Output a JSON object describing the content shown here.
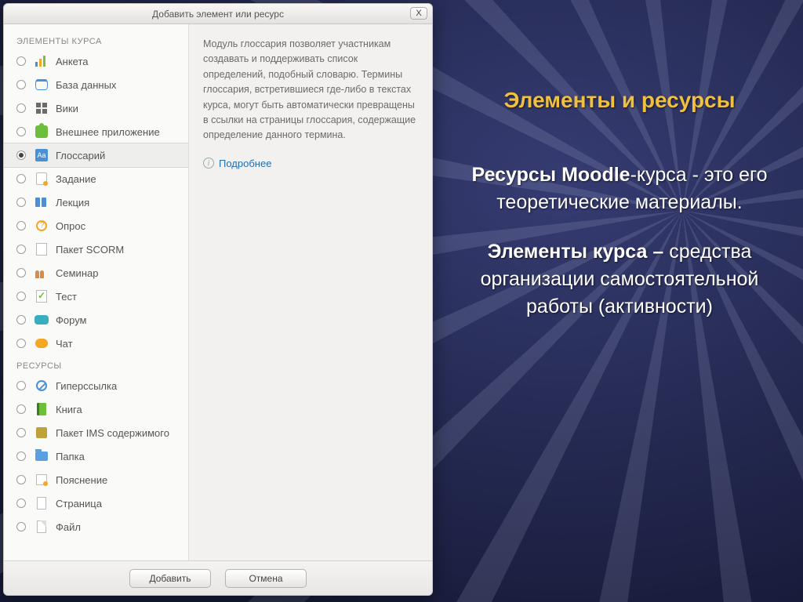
{
  "slide": {
    "title": "Элементы и ресурсы",
    "para1_lead": "Ресурсы Moodle",
    "para1_rest": "-курса - это его теоретические материалы.",
    "para2_lead": "Элементы курса –",
    "para2_rest": " средства организации самостоятельной работы (активности)"
  },
  "dialog": {
    "title": "Добавить элемент или ресурс",
    "close_label": "X",
    "section_activities": "ЭЛЕМЕНТЫ КУРСА",
    "section_resources": "РЕСУРСЫ",
    "activities": [
      {
        "label": "Анкета",
        "icon": "survey"
      },
      {
        "label": "База данных",
        "icon": "database"
      },
      {
        "label": "Вики",
        "icon": "wiki"
      },
      {
        "label": "Внешнее приложение",
        "icon": "lti"
      },
      {
        "label": "Глоссарий",
        "icon": "glossary",
        "selected": true
      },
      {
        "label": "Задание",
        "icon": "assignment"
      },
      {
        "label": "Лекция",
        "icon": "lesson"
      },
      {
        "label": "Опрос",
        "icon": "choice"
      },
      {
        "label": "Пакет SCORM",
        "icon": "scorm"
      },
      {
        "label": "Семинар",
        "icon": "workshop"
      },
      {
        "label": "Тест",
        "icon": "quiz"
      },
      {
        "label": "Форум",
        "icon": "forum"
      },
      {
        "label": "Чат",
        "icon": "chat"
      }
    ],
    "resources": [
      {
        "label": "Гиперссылка",
        "icon": "url"
      },
      {
        "label": "Книга",
        "icon": "book"
      },
      {
        "label": "Пакет IMS содержимого",
        "icon": "ims"
      },
      {
        "label": "Папка",
        "icon": "folder"
      },
      {
        "label": "Пояснение",
        "icon": "label"
      },
      {
        "label": "Страница",
        "icon": "page"
      },
      {
        "label": "Файл",
        "icon": "file"
      }
    ],
    "description": "Модуль глоссария позволяет участникам создавать и поддерживать список определений, подобный словарю. Термины глоссария, встретившиеся где-либо в текстах курса, могут быть автоматически превращены в ссылки на страницы глоссария, содержащие определение данного термина.",
    "more_label": "Подробнее",
    "add_button": "Добавить",
    "cancel_button": "Отмена"
  }
}
